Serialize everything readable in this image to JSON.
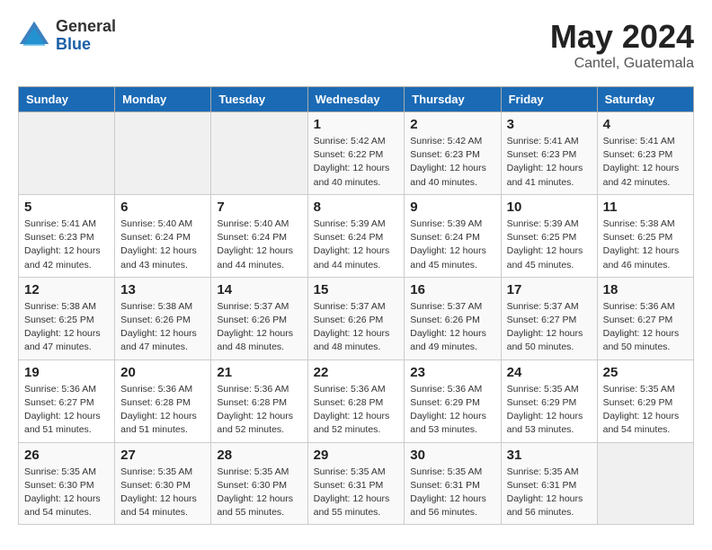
{
  "header": {
    "logo_general": "General",
    "logo_blue": "Blue",
    "title": "May 2024",
    "subtitle": "Cantel, Guatemala"
  },
  "days_of_week": [
    "Sunday",
    "Monday",
    "Tuesday",
    "Wednesday",
    "Thursday",
    "Friday",
    "Saturday"
  ],
  "weeks": [
    [
      {
        "day": "",
        "info": ""
      },
      {
        "day": "",
        "info": ""
      },
      {
        "day": "",
        "info": ""
      },
      {
        "day": "1",
        "info": "Sunrise: 5:42 AM\nSunset: 6:22 PM\nDaylight: 12 hours\nand 40 minutes."
      },
      {
        "day": "2",
        "info": "Sunrise: 5:42 AM\nSunset: 6:23 PM\nDaylight: 12 hours\nand 40 minutes."
      },
      {
        "day": "3",
        "info": "Sunrise: 5:41 AM\nSunset: 6:23 PM\nDaylight: 12 hours\nand 41 minutes."
      },
      {
        "day": "4",
        "info": "Sunrise: 5:41 AM\nSunset: 6:23 PM\nDaylight: 12 hours\nand 42 minutes."
      }
    ],
    [
      {
        "day": "5",
        "info": "Sunrise: 5:41 AM\nSunset: 6:23 PM\nDaylight: 12 hours\nand 42 minutes."
      },
      {
        "day": "6",
        "info": "Sunrise: 5:40 AM\nSunset: 6:24 PM\nDaylight: 12 hours\nand 43 minutes."
      },
      {
        "day": "7",
        "info": "Sunrise: 5:40 AM\nSunset: 6:24 PM\nDaylight: 12 hours\nand 44 minutes."
      },
      {
        "day": "8",
        "info": "Sunrise: 5:39 AM\nSunset: 6:24 PM\nDaylight: 12 hours\nand 44 minutes."
      },
      {
        "day": "9",
        "info": "Sunrise: 5:39 AM\nSunset: 6:24 PM\nDaylight: 12 hours\nand 45 minutes."
      },
      {
        "day": "10",
        "info": "Sunrise: 5:39 AM\nSunset: 6:25 PM\nDaylight: 12 hours\nand 45 minutes."
      },
      {
        "day": "11",
        "info": "Sunrise: 5:38 AM\nSunset: 6:25 PM\nDaylight: 12 hours\nand 46 minutes."
      }
    ],
    [
      {
        "day": "12",
        "info": "Sunrise: 5:38 AM\nSunset: 6:25 PM\nDaylight: 12 hours\nand 47 minutes."
      },
      {
        "day": "13",
        "info": "Sunrise: 5:38 AM\nSunset: 6:26 PM\nDaylight: 12 hours\nand 47 minutes."
      },
      {
        "day": "14",
        "info": "Sunrise: 5:37 AM\nSunset: 6:26 PM\nDaylight: 12 hours\nand 48 minutes."
      },
      {
        "day": "15",
        "info": "Sunrise: 5:37 AM\nSunset: 6:26 PM\nDaylight: 12 hours\nand 48 minutes."
      },
      {
        "day": "16",
        "info": "Sunrise: 5:37 AM\nSunset: 6:26 PM\nDaylight: 12 hours\nand 49 minutes."
      },
      {
        "day": "17",
        "info": "Sunrise: 5:37 AM\nSunset: 6:27 PM\nDaylight: 12 hours\nand 50 minutes."
      },
      {
        "day": "18",
        "info": "Sunrise: 5:36 AM\nSunset: 6:27 PM\nDaylight: 12 hours\nand 50 minutes."
      }
    ],
    [
      {
        "day": "19",
        "info": "Sunrise: 5:36 AM\nSunset: 6:27 PM\nDaylight: 12 hours\nand 51 minutes."
      },
      {
        "day": "20",
        "info": "Sunrise: 5:36 AM\nSunset: 6:28 PM\nDaylight: 12 hours\nand 51 minutes."
      },
      {
        "day": "21",
        "info": "Sunrise: 5:36 AM\nSunset: 6:28 PM\nDaylight: 12 hours\nand 52 minutes."
      },
      {
        "day": "22",
        "info": "Sunrise: 5:36 AM\nSunset: 6:28 PM\nDaylight: 12 hours\nand 52 minutes."
      },
      {
        "day": "23",
        "info": "Sunrise: 5:36 AM\nSunset: 6:29 PM\nDaylight: 12 hours\nand 53 minutes."
      },
      {
        "day": "24",
        "info": "Sunrise: 5:35 AM\nSunset: 6:29 PM\nDaylight: 12 hours\nand 53 minutes."
      },
      {
        "day": "25",
        "info": "Sunrise: 5:35 AM\nSunset: 6:29 PM\nDaylight: 12 hours\nand 54 minutes."
      }
    ],
    [
      {
        "day": "26",
        "info": "Sunrise: 5:35 AM\nSunset: 6:30 PM\nDaylight: 12 hours\nand 54 minutes."
      },
      {
        "day": "27",
        "info": "Sunrise: 5:35 AM\nSunset: 6:30 PM\nDaylight: 12 hours\nand 54 minutes."
      },
      {
        "day": "28",
        "info": "Sunrise: 5:35 AM\nSunset: 6:30 PM\nDaylight: 12 hours\nand 55 minutes."
      },
      {
        "day": "29",
        "info": "Sunrise: 5:35 AM\nSunset: 6:31 PM\nDaylight: 12 hours\nand 55 minutes."
      },
      {
        "day": "30",
        "info": "Sunrise: 5:35 AM\nSunset: 6:31 PM\nDaylight: 12 hours\nand 56 minutes."
      },
      {
        "day": "31",
        "info": "Sunrise: 5:35 AM\nSunset: 6:31 PM\nDaylight: 12 hours\nand 56 minutes."
      },
      {
        "day": "",
        "info": ""
      }
    ]
  ]
}
